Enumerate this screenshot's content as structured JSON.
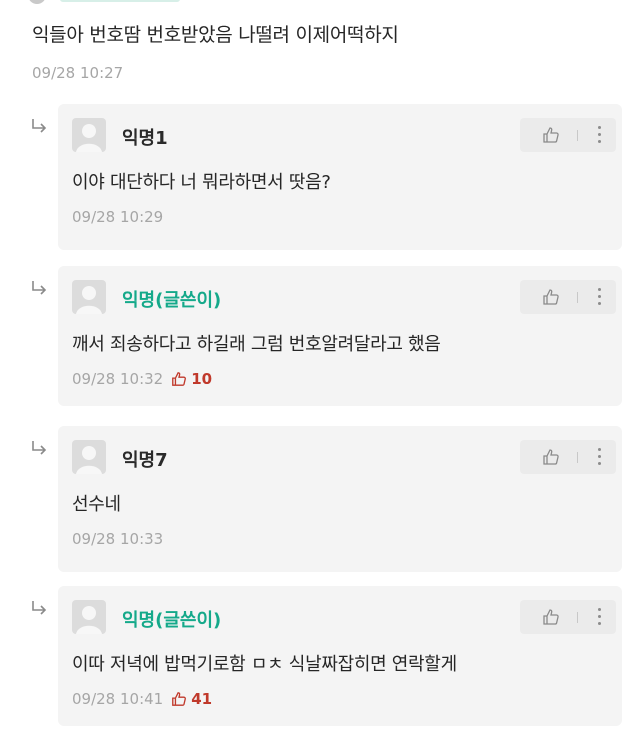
{
  "parent": {
    "text": "익들아 번호땀 번호받았음 나떨려 이제어떡하지",
    "time": "09/28 10:27"
  },
  "replies": [
    {
      "author": "익명1",
      "text": "이야 대단하다 너 뭐라하면서 땃음?",
      "time": "09/28 10:29",
      "likes": "",
      "is_op": false
    },
    {
      "author": "익명(글쓴이)",
      "text": "깨서 죄송하다고 하길래 그럼 번호알려달라고 했음",
      "time": "09/28 10:32",
      "likes": "10",
      "is_op": true
    },
    {
      "author": "익명7",
      "text": "선수네",
      "time": "09/28 10:33",
      "likes": "",
      "is_op": false
    },
    {
      "author": "익명(글쓴이)",
      "text": "이따 저녁에 밥먹기로함 ㅁㅊ 식날짜잡히면 연락할게",
      "time": "09/28 10:41",
      "likes": "41",
      "is_op": true
    }
  ],
  "icons": {
    "reply": "reply-arrow-icon",
    "like": "thumbs-up-icon",
    "more": "more-vertical-icon",
    "avatar": "default-avatar-icon"
  },
  "colors": {
    "op_author": "#15a98a",
    "like_count": "#c0392b",
    "card_bg": "#f4f4f4",
    "meta": "#a6a6a6"
  }
}
